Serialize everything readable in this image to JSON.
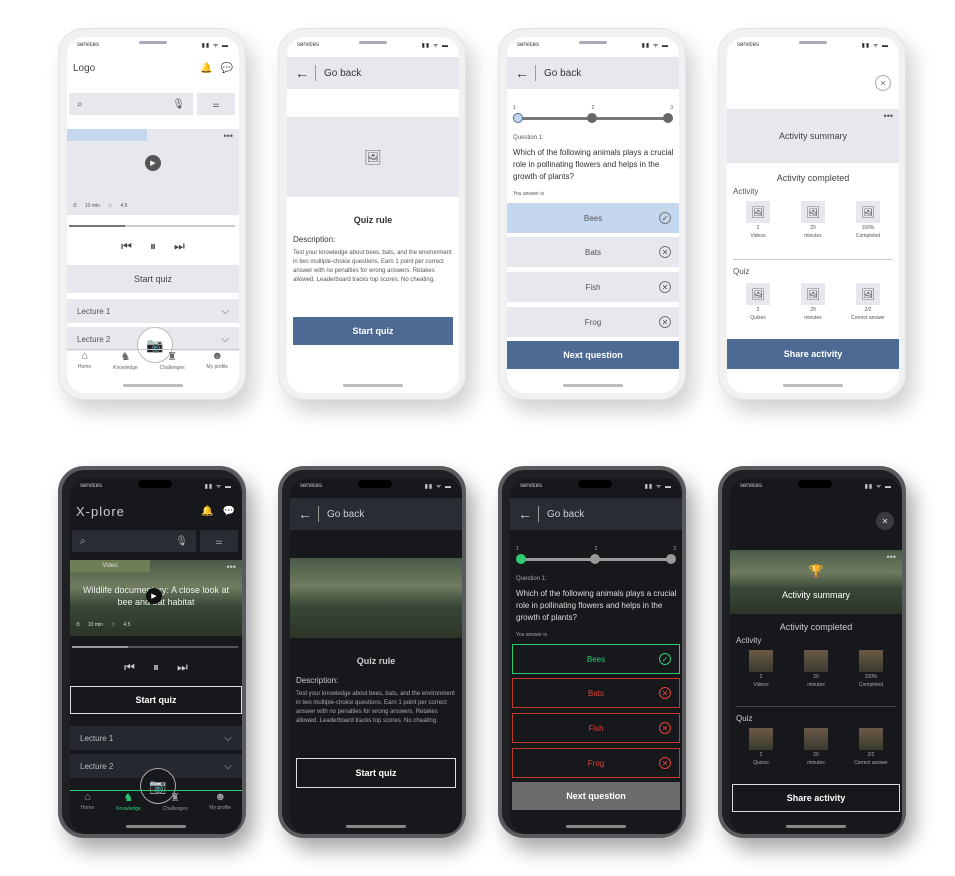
{
  "status": {
    "carrier": "services",
    "signal": "▮▮ ᯤ ▬"
  },
  "home": {
    "logo_light": "Logo",
    "logo_dark": "X-plore",
    "video_tag": "Video",
    "video_title": "Wildlife documentary: A close look at bee and bat habitat",
    "duration": "10 min",
    "rating": "4.5",
    "start_quiz": "Start quiz",
    "lecture1": "Lecture 1",
    "lecture2": "Lecture 2"
  },
  "nav": {
    "home": "Home",
    "knowledge": "Knowledge",
    "challenges": "Challenges",
    "profile": "My profile"
  },
  "rule": {
    "go_back": "Go back",
    "title": "Quiz rule",
    "desc_label": "Description:",
    "desc": "Test your knowledge about bees, bats, and the environment in two multiple-choice questions. Earn 1 point per correct answer with no penalties for wrong answers. Retakes allowed. Leaderboard tracks top scores. No cheating.",
    "start": "Start quiz"
  },
  "question": {
    "go_back": "Go back",
    "steps": [
      "1",
      "2",
      "3"
    ],
    "label": "Question 1:",
    "text": "Which of the following animals plays a crucial role in pollinating flowers and helps in the growth of plants?",
    "answer_label": "You answer is",
    "options": [
      "Bees",
      "Bats",
      "Fish",
      "Frog"
    ],
    "next": "Next question"
  },
  "summary": {
    "title": "Activity summary",
    "completed": "Activity completed",
    "activity": "Activity",
    "quiz": "Quiz",
    "act_items": [
      {
        "v": "2",
        "l": "Videos"
      },
      {
        "v": "20",
        "l": "minutes"
      },
      {
        "v": "100%",
        "l": "Completed"
      }
    ],
    "quiz_items": [
      {
        "v": "2",
        "l": "Quizes"
      },
      {
        "v": "20",
        "l": "minutes"
      },
      {
        "v": "2/2",
        "l": "Correct answer"
      }
    ],
    "share": "Share activity"
  },
  "colors": {
    "primary_light": "#4c6a93",
    "correct": "#2ecc71",
    "wrong": "#e0443a"
  }
}
